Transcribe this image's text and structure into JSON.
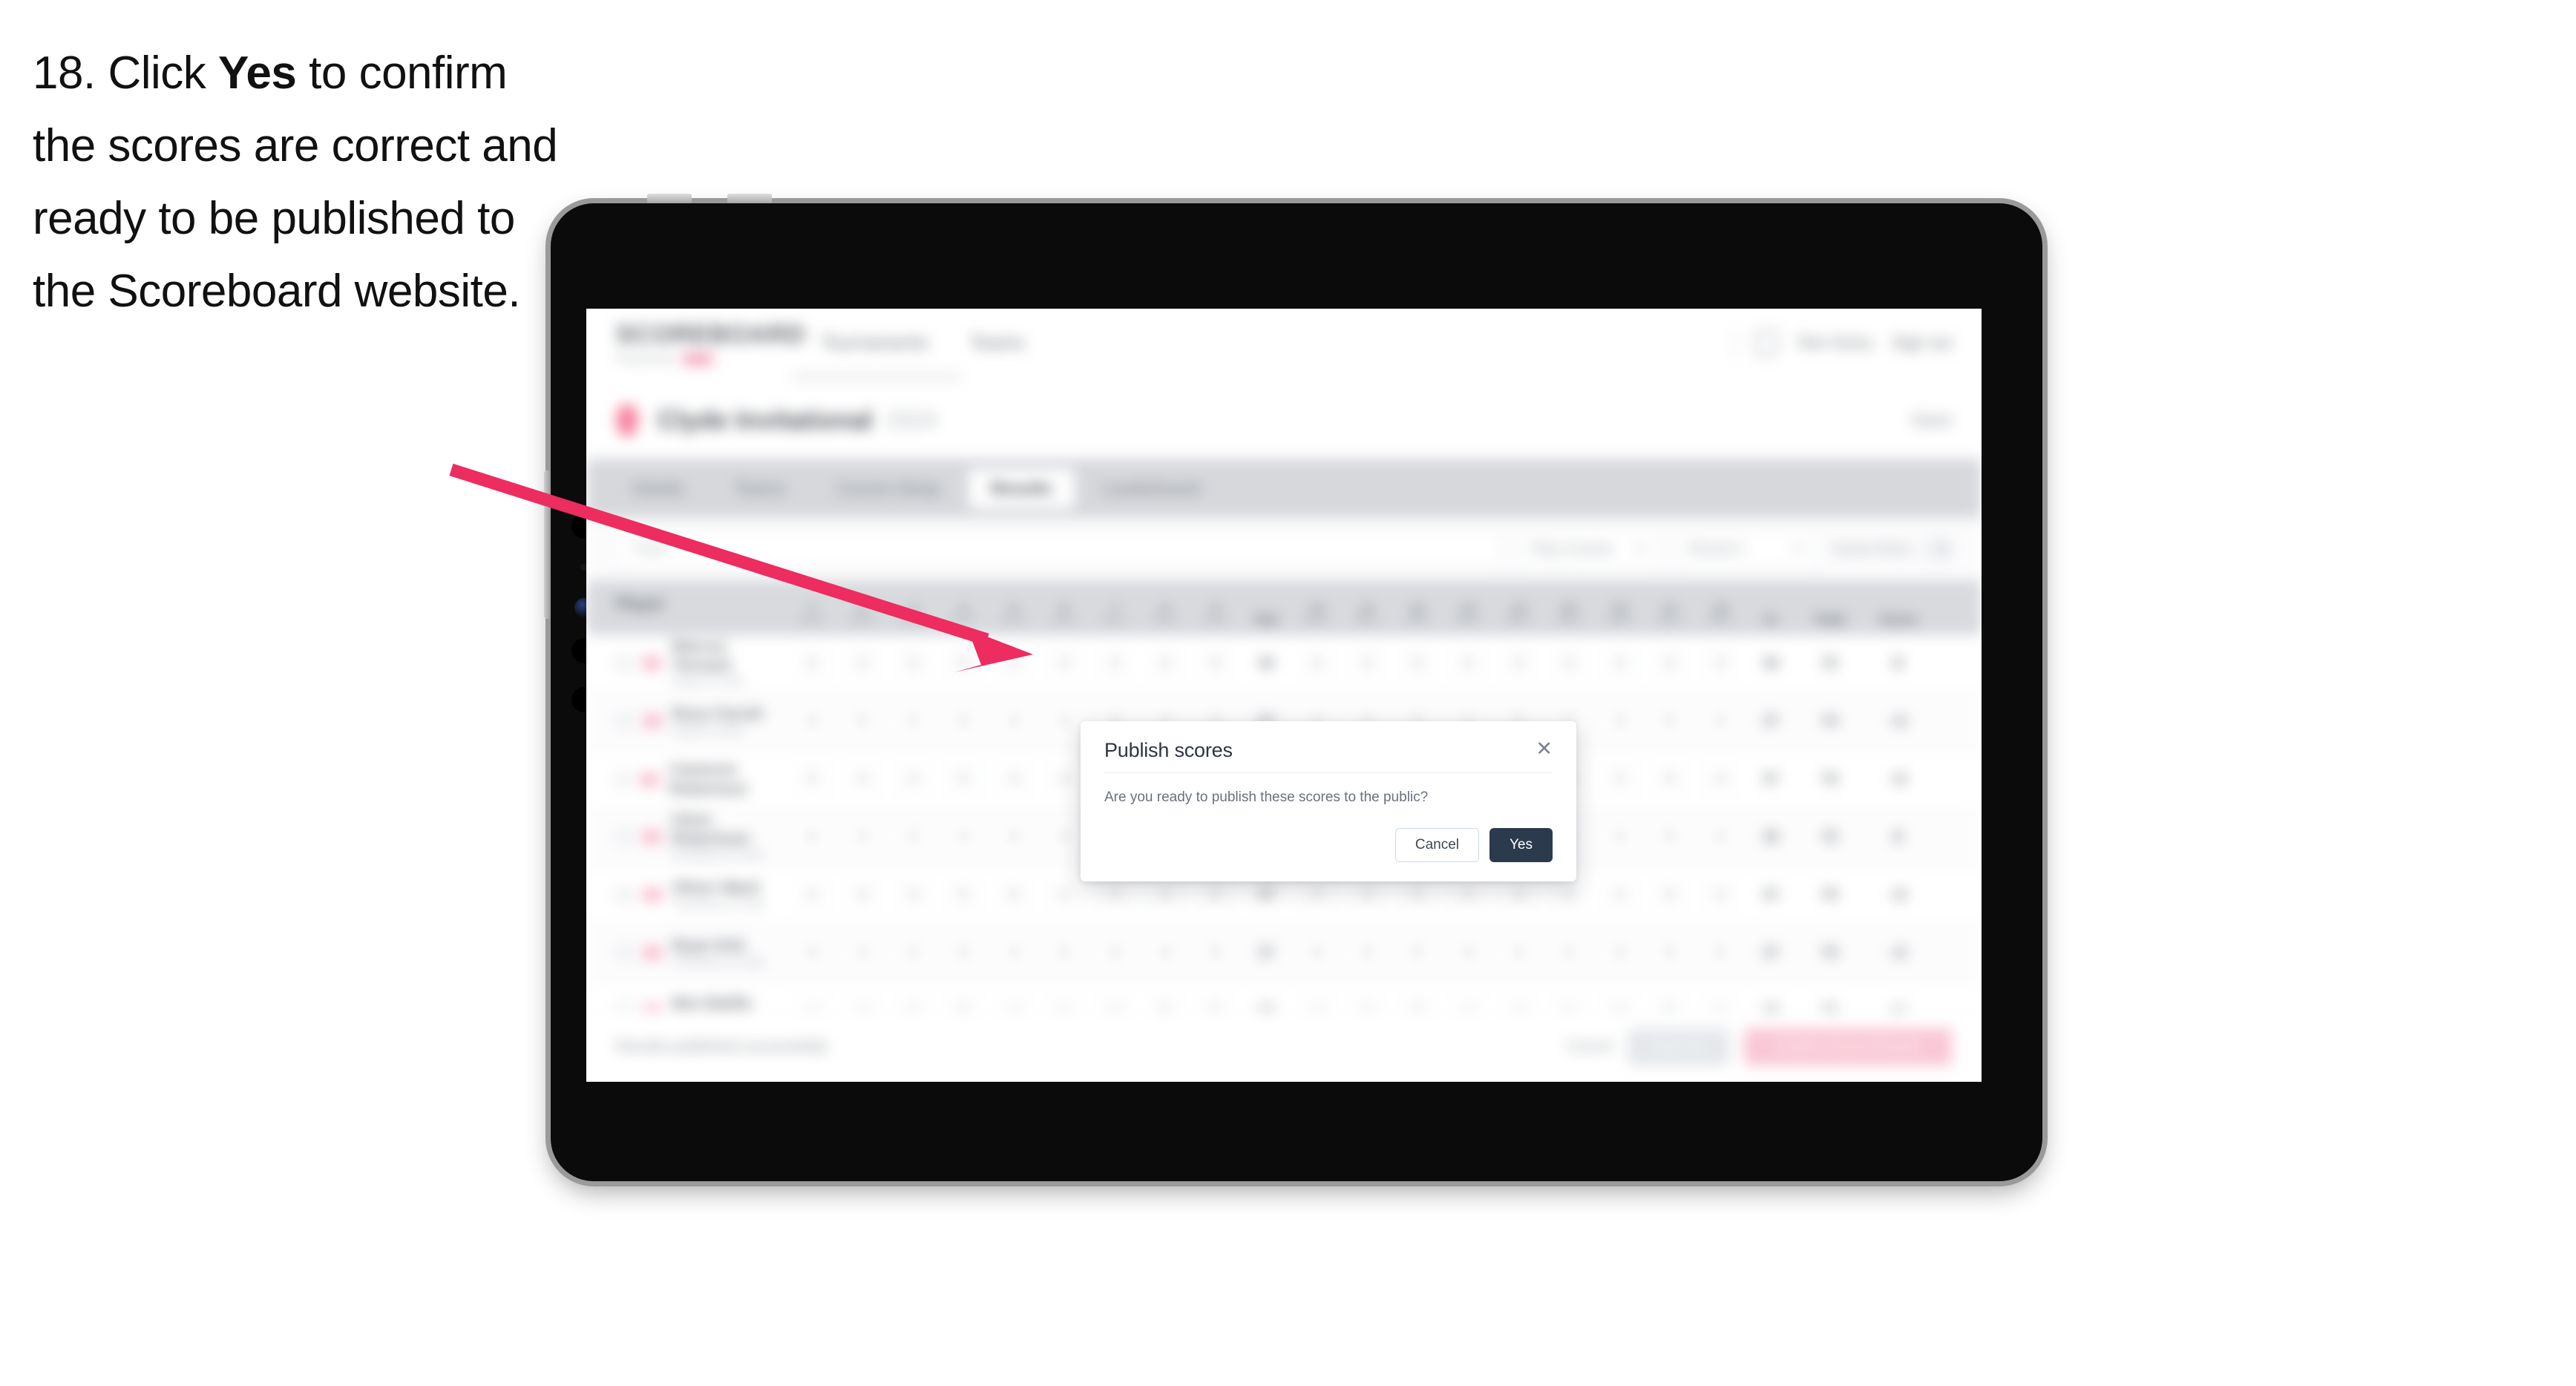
{
  "caption": {
    "number": "18.",
    "text_before": "Click",
    "bold_word": "Yes",
    "text_after": "to confirm the scores are correct and ready to be published to the Scoreboard website."
  },
  "annotation": {
    "arrow_color": "#ed2c5f",
    "arrow_start": "608,633",
    "arrow_end": "1380,878"
  },
  "device": {
    "type": "tablet",
    "body_color": "#0b0b0c",
    "bezel_color": "#9a9a9c"
  },
  "app": {
    "header": {
      "logo": "SCOREBOARD",
      "logo_sub": "Powered by",
      "logo_badge": "R&A",
      "nav": [
        {
          "label": "Tournaments"
        },
        {
          "label": "Teams"
        }
      ],
      "user_name": "Tom Gorry",
      "sign_out": "Sign out",
      "user_icon": "user-icon"
    },
    "title_row": {
      "icon": "flag-icon",
      "title": "Clyde Invitational",
      "subtitle": "2024",
      "action": "Save"
    },
    "tabs": [
      {
        "label": "Details",
        "active": false
      },
      {
        "label": "Teams",
        "active": false
      },
      {
        "label": "Course Setup",
        "active": false
      },
      {
        "label": "Results",
        "active": true
      },
      {
        "label": "Leaderboard",
        "active": false
      }
    ],
    "filter_bar": {
      "search_placeholder": "Filter",
      "dropdowns": [
        {
          "label": "Play Course"
        },
        {
          "label": "Round 1"
        }
      ],
      "toggle_label": "Score Entry"
    },
    "table": {
      "player_header": "Player",
      "hole_headers": [
        {
          "no": "1",
          "par": "Par 4"
        },
        {
          "no": "2",
          "par": "Par 4"
        },
        {
          "no": "3",
          "par": "Par 3"
        },
        {
          "no": "4",
          "par": "Par 5"
        },
        {
          "no": "5",
          "par": "Par 4"
        },
        {
          "no": "6",
          "par": "Par 4"
        },
        {
          "no": "7",
          "par": "Par 3"
        },
        {
          "no": "8",
          "par": "Par 4"
        },
        {
          "no": "9",
          "par": "Par 5"
        }
      ],
      "out_header": "Out",
      "hole_headers_back": [
        {
          "no": "10",
          "par": "Par 4"
        },
        {
          "no": "11",
          "par": "Par 3"
        },
        {
          "no": "12",
          "par": "Par 5"
        },
        {
          "no": "13",
          "par": "Par 4"
        },
        {
          "no": "14",
          "par": "Par 4"
        },
        {
          "no": "15",
          "par": "Par 4"
        },
        {
          "no": "16",
          "par": "Par 3"
        },
        {
          "no": "17",
          "par": "Par 5"
        },
        {
          "no": "18",
          "par": "Par 4"
        }
      ],
      "in_header": "In",
      "total_header": "Total",
      "score_header": "Score",
      "rows": [
        {
          "name": "Marcus Tennant",
          "club": "Clyde G Club",
          "front": [
            "4",
            "4",
            "3",
            "5",
            "4",
            "4",
            "3",
            "4",
            "5"
          ],
          "out": "36",
          "back": [
            "4",
            "3",
            "5",
            "4",
            "4",
            "4",
            "3",
            "5",
            "4"
          ],
          "in": "36",
          "total": "72",
          "score": "E"
        },
        {
          "name": "Ross Farrell",
          "club": "Clyde G Club",
          "front": [
            "4",
            "5",
            "3",
            "5",
            "4",
            "4",
            "3",
            "4",
            "5"
          ],
          "out": "37",
          "back": [
            "4",
            "3",
            "5",
            "4",
            "5",
            "4",
            "3",
            "5",
            "4"
          ],
          "in": "37",
          "total": "74",
          "score": "+2"
        },
        {
          "name": "Cameron Robertson",
          "club": "",
          "front": [
            "5",
            "4",
            "3",
            "5",
            "4",
            "4",
            "3",
            "4",
            "5"
          ],
          "out": "37",
          "back": [
            "4",
            "3",
            "5",
            "4",
            "4",
            "5",
            "3",
            "5",
            "4"
          ],
          "in": "37",
          "total": "74",
          "score": "+2"
        },
        {
          "name": "Chris Robertson",
          "club": "Turnberry G Club",
          "front": [
            "4",
            "4",
            "3",
            "4",
            "4",
            "4",
            "3",
            "5",
            "5"
          ],
          "out": "36",
          "back": [
            "4",
            "3",
            "5",
            "4",
            "4",
            "4",
            "3",
            "5",
            "4"
          ],
          "in": "36",
          "total": "72",
          "score": "E"
        },
        {
          "name": "Oliver Ward",
          "club": "Turnberry G Club",
          "front": [
            "4",
            "4",
            "3",
            "5",
            "5",
            "4",
            "3",
            "4",
            "5"
          ],
          "out": "37",
          "back": [
            "4",
            "3",
            "5",
            "4",
            "4",
            "4",
            "4",
            "5",
            "4"
          ],
          "in": "37",
          "total": "74",
          "score": "+2"
        },
        {
          "name": "Ryan Kirk",
          "club": "Turnberry G Club",
          "front": [
            "4",
            "4",
            "3",
            "5",
            "4",
            "5",
            "3",
            "4",
            "5"
          ],
          "out": "37",
          "back": [
            "4",
            "3",
            "5",
            "4",
            "4",
            "4",
            "3",
            "5",
            "5"
          ],
          "in": "37",
          "total": "74",
          "score": "+2"
        },
        {
          "name": "Ben Baillie",
          "club": "Turnberry G Club",
          "front": [
            "4",
            "4",
            "3",
            "5",
            "4",
            "4",
            "3",
            "5",
            "5"
          ],
          "out": "37",
          "back": [
            "4",
            "3",
            "5",
            "4",
            "4",
            "4",
            "3",
            "5",
            "4"
          ],
          "in": "36",
          "total": "73",
          "score": "+1"
        }
      ]
    },
    "bottom_bar": {
      "status": "Results published successfully",
      "link": "Cancel",
      "secondary_button": "Save All",
      "primary_button": "Publish Round Results"
    }
  },
  "modal": {
    "title": "Publish scores",
    "close_icon": "close-icon",
    "body": "Are you ready to publish these scores to the public?",
    "cancel_label": "Cancel",
    "confirm_label": "Yes",
    "confirm_color": "#2c3a4e"
  }
}
